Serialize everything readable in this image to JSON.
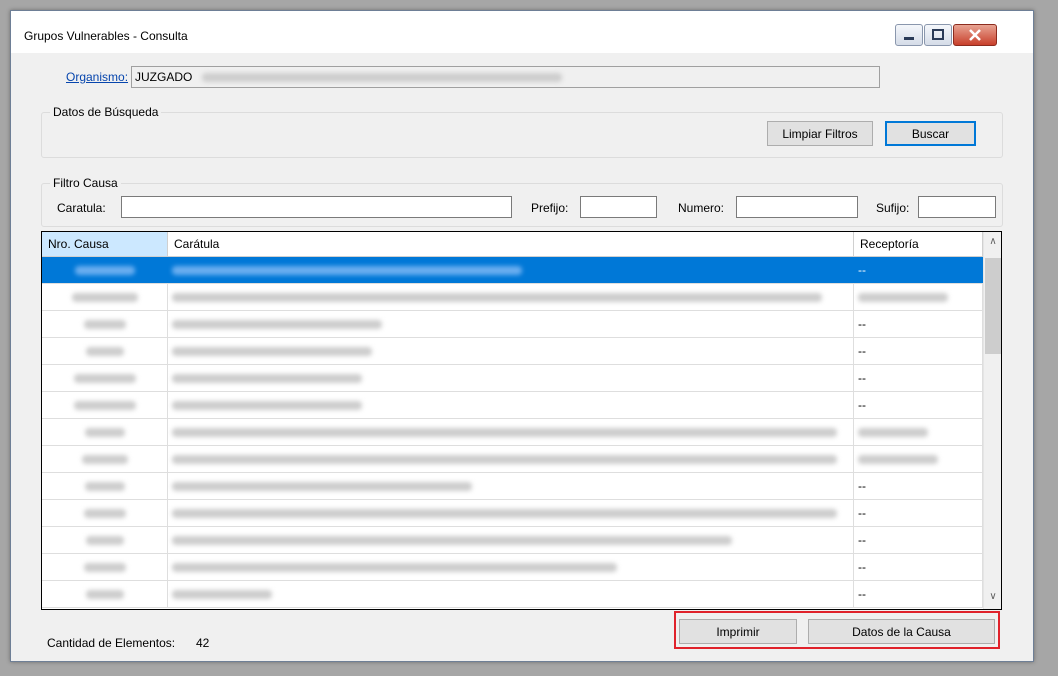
{
  "window": {
    "title": "Grupos Vulnerables - Consulta"
  },
  "organismo": {
    "label": "Organismo:",
    "value": "JUZGADO"
  },
  "busqueda": {
    "group_title": "Datos de Búsqueda",
    "limpiar_label": "Limpiar Filtros",
    "buscar_label": "Buscar"
  },
  "filtro": {
    "group_title": "Filtro Causa",
    "caratula_label": "Caratula:",
    "prefijo_label": "Prefijo:",
    "numero_label": "Numero:",
    "sufijo_label": "Sufijo:"
  },
  "table": {
    "columns": [
      "Nro. Causa",
      "Carátula",
      "Receptoría"
    ],
    "rows": [
      {
        "receptoria": "--",
        "selected": true
      },
      {
        "receptoria": ""
      },
      {
        "receptoria": "--"
      },
      {
        "receptoria": "--"
      },
      {
        "receptoria": "--"
      },
      {
        "receptoria": "--"
      },
      {
        "receptoria": ""
      },
      {
        "receptoria": ""
      },
      {
        "receptoria": "--"
      },
      {
        "receptoria": "--"
      },
      {
        "receptoria": "--"
      },
      {
        "receptoria": "--"
      },
      {
        "receptoria": "--"
      }
    ]
  },
  "footer": {
    "count_label": "Cantidad de Elementos:",
    "count_value": "42",
    "imprimir_label": "Imprimir",
    "datos_causa_label": "Datos de la Causa"
  },
  "colors": {
    "selection": "#0078d7",
    "highlight": "#e0222b",
    "link": "#0645ad"
  },
  "icons": [
    "minimize-icon",
    "maximize-icon",
    "close-icon",
    "scroll-up-icon",
    "scroll-down-icon"
  ]
}
